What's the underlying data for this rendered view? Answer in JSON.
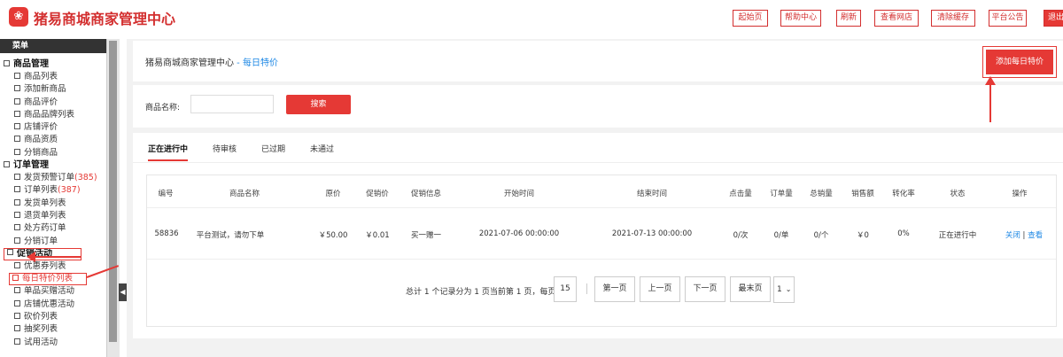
{
  "header": {
    "logo_glyph": "❀",
    "title": "猪易商城商家管理中心",
    "buttons": [
      "起始页",
      "帮助中心",
      "刷新",
      "查看网店",
      "清除缓存",
      "平台公告",
      "退出"
    ]
  },
  "sidebar": {
    "title": "菜单",
    "groups": [
      {
        "label": "商品管理",
        "items": [
          {
            "label": "商品列表"
          },
          {
            "label": "添加新商品"
          },
          {
            "label": "商品评价"
          },
          {
            "label": "商品品牌列表"
          },
          {
            "label": "店铺评价"
          },
          {
            "label": "商品资质"
          },
          {
            "label": "分销商品"
          }
        ]
      },
      {
        "label": "订单管理",
        "items": [
          {
            "label": "发货预警订单",
            "count": "(385)"
          },
          {
            "label": "订单列表",
            "count": "(387)"
          },
          {
            "label": "发货单列表"
          },
          {
            "label": "退货单列表"
          },
          {
            "label": "处方药订单"
          },
          {
            "label": "分销订单"
          }
        ]
      },
      {
        "label": "促销活动",
        "items": [
          {
            "label": "优惠券列表"
          },
          {
            "label": "每日特价列表"
          },
          {
            "label": "单品买赠活动"
          },
          {
            "label": "店铺优惠活动"
          },
          {
            "label": "砍价列表"
          },
          {
            "label": "抽奖列表"
          },
          {
            "label": "试用活动"
          }
        ]
      }
    ]
  },
  "breadcrumb": {
    "home": "猪易商城商家管理中心",
    "sep": " - ",
    "current": "每日特价"
  },
  "add_button": "添加每日特价",
  "search": {
    "label": "商品名称:",
    "value": "",
    "button": "搜索"
  },
  "tabs": [
    "正在进行中",
    "待审核",
    "已过期",
    "未通过"
  ],
  "table": {
    "headers": [
      "编号",
      "商品名称",
      "原价",
      "促销价",
      "促销信息",
      "开始时间",
      "结束时间",
      "点击量",
      "订单量",
      "总销量",
      "销售额",
      "转化率",
      "状态",
      "操作"
    ],
    "rows": [
      {
        "id": "58836",
        "name": "平台测试，请勿下单",
        "price": "￥50.00",
        "promo_price": "￥0.01",
        "promo_info": "买一赠一",
        "start": "2021-07-06 00:00:00",
        "end": "2021-07-13 00:00:00",
        "clicks": "0/次",
        "orders": "0/单",
        "sales": "0/个",
        "revenue": "￥0",
        "conversion": "0%",
        "status": "正在进行中",
        "action_close": "关闭",
        "action_sep": " | ",
        "action_view": "查看"
      }
    ]
  },
  "pagination": {
    "summary": "总计 1 个记录分为 1 页当前第 1 页，每页",
    "page_size": "15",
    "first": "第一页",
    "prev": "上一页",
    "next": "下一页",
    "last": "最末页",
    "page_select": "1"
  },
  "colors": {
    "accent": "#e53935",
    "link": "#1e88e5"
  }
}
